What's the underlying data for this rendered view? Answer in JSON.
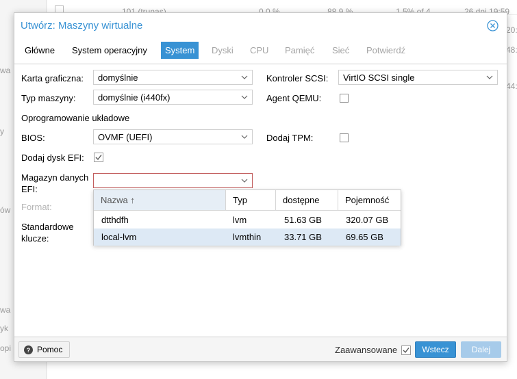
{
  "background": {
    "row_fragments": [
      "101 (trunas)",
      "0.0 %",
      "88.9 %",
      "1.5% of 4",
      "26 dni 19:59"
    ],
    "right_fragments": [
      "20:",
      "48:",
      "44:"
    ],
    "left_fragments": [
      "wa",
      "y",
      "ów",
      "wa",
      "yk",
      "opi"
    ]
  },
  "dialog": {
    "title": "Utwórz: Maszyny wirtualne",
    "tabs": [
      {
        "label": "Główne",
        "state": "normal"
      },
      {
        "label": "System operacyjny",
        "state": "normal"
      },
      {
        "label": "System",
        "state": "active"
      },
      {
        "label": "Dyski",
        "state": "disabled"
      },
      {
        "label": "CPU",
        "state": "disabled"
      },
      {
        "label": "Pamięć",
        "state": "disabled"
      },
      {
        "label": "Sieć",
        "state": "disabled"
      },
      {
        "label": "Potwierdź",
        "state": "disabled"
      }
    ],
    "form": {
      "graphics_card": {
        "label": "Karta graficzna:",
        "value": "domyślnie"
      },
      "machine_type": {
        "label": "Typ maszyny:",
        "value": "domyślnie (i440fx)"
      },
      "firmware_section": "Oprogramowanie układowe",
      "bios": {
        "label": "BIOS:",
        "value": "OVMF (UEFI)"
      },
      "add_efi_disk": {
        "label": "Dodaj dysk EFI:",
        "checked": true
      },
      "efi_storage": {
        "label": "Magazyn danych EFI:",
        "value": ""
      },
      "format": {
        "label": "Format:"
      },
      "standard_keys": {
        "label": "Standardowe klucze:"
      },
      "scsi_controller": {
        "label": "Kontroler SCSI:",
        "value": "VirtIO SCSI single"
      },
      "qemu_agent": {
        "label": "Agent QEMU:",
        "checked": false
      },
      "add_tpm": {
        "label": "Dodaj TPM:",
        "checked": false
      }
    },
    "storage_dropdown": {
      "columns": [
        "Nazwa ↑",
        "Typ",
        "dostępne",
        "Pojemność"
      ],
      "rows": [
        {
          "name": "dtthdfh",
          "type": "lvm",
          "available": "51.63 GB",
          "capacity": "320.07 GB",
          "selected": false
        },
        {
          "name": "local-lvm",
          "type": "lvmthin",
          "available": "33.71 GB",
          "capacity": "69.65 GB",
          "selected": true
        }
      ]
    },
    "footer": {
      "help": "Pomoc",
      "advanced": "Zaawansowane",
      "advanced_checked": true,
      "back": "Wstecz",
      "next": "Dalej"
    }
  },
  "colors": {
    "accent": "#3892d4",
    "disabled_button": "#a7cbea",
    "invalid_border": "#c25d5d",
    "selected_row": "#dde9f5"
  }
}
